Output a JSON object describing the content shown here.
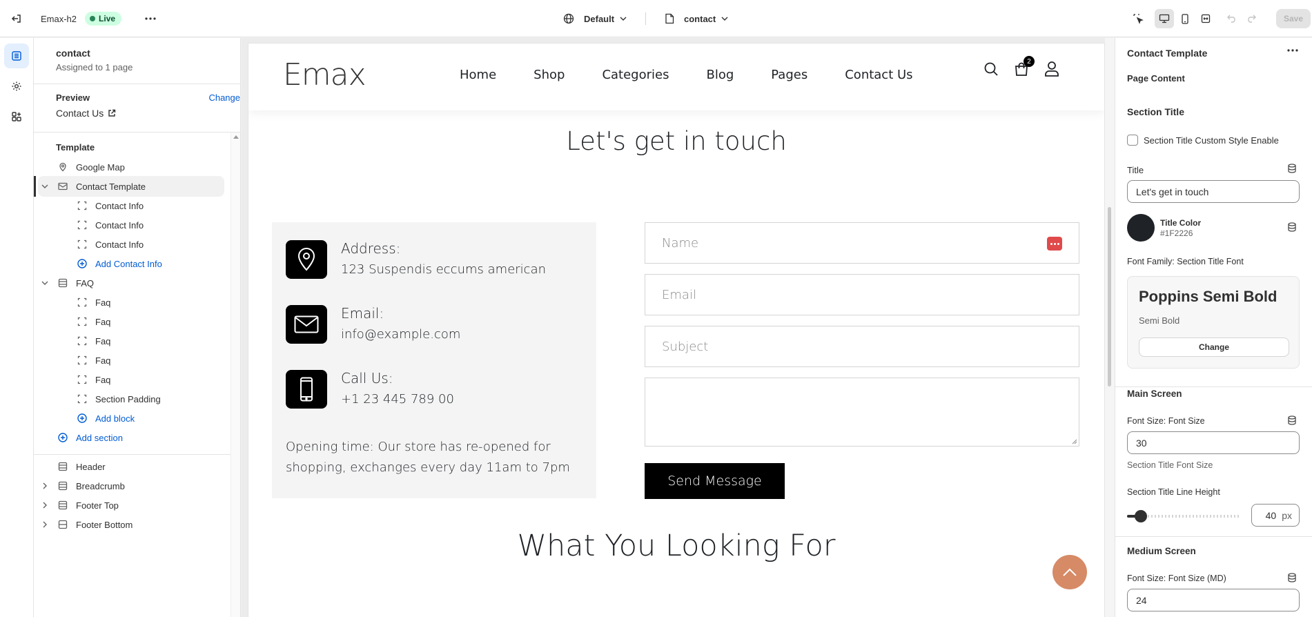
{
  "topbar": {
    "store_name": "Emax-h2",
    "live_label": "Live",
    "theme_selector": "Default",
    "page_selector": "contact",
    "save_label": "Save"
  },
  "sidebar": {
    "title": "contact",
    "subtitle": "Assigned to 1 page",
    "preview_label": "Preview",
    "preview_change": "Change",
    "preview_value": "Contact Us",
    "template_heading": "Template",
    "items": [
      {
        "label": "Google Map",
        "level": 0,
        "icon": "map-pin-icon"
      },
      {
        "label": "Contact Template",
        "level": 0,
        "icon": "envelope-icon",
        "selected": true,
        "expanded": true
      },
      {
        "label": "Contact Info",
        "level": 1,
        "icon": "block-icon"
      },
      {
        "label": "Contact Info",
        "level": 1,
        "icon": "block-icon"
      },
      {
        "label": "Contact Info",
        "level": 1,
        "icon": "block-icon"
      },
      {
        "label": "Add Contact Info",
        "level": 1,
        "icon": "add-icon",
        "add": true
      },
      {
        "label": "FAQ",
        "level": 0,
        "icon": "section-icon",
        "expanded": true
      },
      {
        "label": "Faq",
        "level": 1,
        "icon": "block-icon"
      },
      {
        "label": "Faq",
        "level": 1,
        "icon": "block-icon"
      },
      {
        "label": "Faq",
        "level": 1,
        "icon": "block-icon"
      },
      {
        "label": "Faq",
        "level": 1,
        "icon": "block-icon"
      },
      {
        "label": "Faq",
        "level": 1,
        "icon": "block-icon"
      },
      {
        "label": "Section Padding",
        "level": 1,
        "icon": "block-icon"
      },
      {
        "label": "Add block",
        "level": 1,
        "icon": "add-icon",
        "add": true
      },
      {
        "label": "Add section",
        "level": 0,
        "icon": "add-icon",
        "add": true
      }
    ],
    "group_items": [
      {
        "label": "Header",
        "icon": "section-icon",
        "chevron": false
      },
      {
        "label": "Breadcrumb",
        "icon": "section-icon",
        "chevron": true
      },
      {
        "label": "Footer Top",
        "icon": "section-icon",
        "chevron": true
      },
      {
        "label": "Footer Bottom",
        "icon": "section-icon",
        "chevron": true
      }
    ]
  },
  "site": {
    "logo": "Emax",
    "nav": [
      "Home",
      "Shop",
      "Categories",
      "Blog",
      "Pages",
      "Contact Us"
    ],
    "cart_count": "2",
    "contact_title": "Let's get in touch",
    "info": [
      {
        "head": "Address:",
        "value": "123 Suspendis eccums american",
        "icon": "location-pin-icon"
      },
      {
        "head": "Email:",
        "value": "info@example.com",
        "icon": "mail-icon"
      },
      {
        "head": "Call Us:",
        "value": "+1 23 445 789 00",
        "icon": "phone-icon"
      }
    ],
    "opening": "Opening time: Our store has re-opened for shopping, exchanges every day 11am to 7pm",
    "form": {
      "name": "Name",
      "email": "Email",
      "subject": "Subject",
      "send": "Send Message"
    },
    "faq_title": "What You Looking For"
  },
  "panel": {
    "title": "Contact Template",
    "page_content": "Page Content",
    "section_title": "Section Title",
    "custom_style_label": "Section Title Custom Style Enable",
    "title_label": "Title",
    "title_value": "Let's get in touch",
    "title_color_label": "Title Color",
    "title_color_value": "#1F2226",
    "font_family_label": "Font Family: Section Title Font",
    "font_name": "Poppins Semi Bold",
    "font_weight": "Semi Bold",
    "font_change": "Change",
    "main_screen": "Main Screen",
    "font_size_label": "Font Size: Font Size",
    "font_size_value": "30",
    "font_size_help": "Section Title Font Size",
    "line_height_label": "Section Title Line Height",
    "line_height_value": "40",
    "line_height_unit": "px",
    "line_height_fraction": 0.12,
    "medium_screen": "Medium Screen",
    "font_size_md_label": "Font Size: Font Size (MD)",
    "font_size_md_value": "24"
  },
  "colors": {
    "accent": "#005bd3",
    "title": "#1F2226",
    "to_top": "#d68a66",
    "live_bg": "#cdfee1"
  }
}
